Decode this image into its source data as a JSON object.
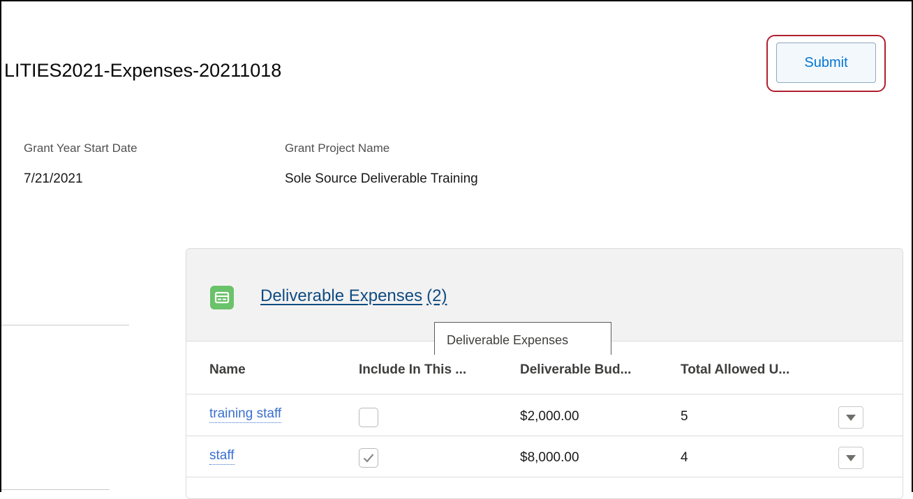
{
  "record": {
    "title": "LITIES2021-Expenses-20211018"
  },
  "actions": {
    "submit_label": "Submit"
  },
  "fields": {
    "grant_year_start_date": {
      "label": "Grant Year Start Date",
      "value": "7/21/2021"
    },
    "grant_project_name": {
      "label": "Grant Project Name",
      "value": "Sole Source Deliverable Training"
    }
  },
  "related_list": {
    "title": "Deliverable Expenses",
    "count": "(2)",
    "icon": "deliverable-card-icon",
    "icon_color": "#6ac26a",
    "tooltip": "Deliverable Expenses",
    "columns": [
      "Name",
      "Include In This ...",
      "Deliverable Bud...",
      "Total Allowed U..."
    ],
    "rows": [
      {
        "name": "training staff",
        "include": false,
        "budget": "$2,000.00",
        "total_allowed": "5"
      },
      {
        "name": "staff",
        "include": true,
        "budget": "$8,000.00",
        "total_allowed": "4"
      }
    ]
  },
  "colors": {
    "link": "#3a6fd0",
    "title_link": "#0f4c81",
    "submit_text": "#0176d3",
    "highlight_border": "#b0202e"
  }
}
